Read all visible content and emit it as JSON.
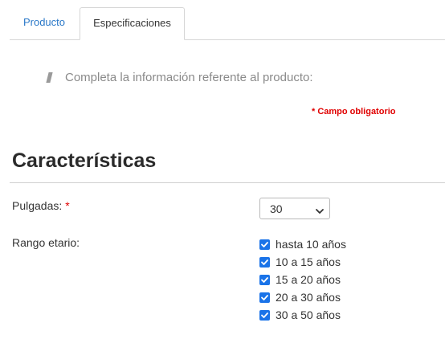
{
  "tabs": {
    "producto": "Producto",
    "especificaciones": "Especificaciones",
    "active": "especificaciones"
  },
  "info": {
    "text": "Completa la información referente al producto:"
  },
  "required_note": "* Campo obligatorio",
  "section": {
    "title": "Características"
  },
  "fields": {
    "pulgadas": {
      "label": "Pulgadas:",
      "required_mark": "*",
      "value": "30"
    },
    "rango_etario": {
      "label": "Rango etario:",
      "options": [
        {
          "label": "hasta 10 años",
          "checked": true
        },
        {
          "label": "10 a 15 años",
          "checked": true
        },
        {
          "label": "15 a 20 años",
          "checked": true
        },
        {
          "label": "20 a 30 años",
          "checked": true
        },
        {
          "label": "30 a 50 años",
          "checked": true
        }
      ]
    }
  },
  "colors": {
    "active_tab_link": "#2a78c8",
    "required": "#e00000",
    "checkbox": "#1a73e8"
  }
}
